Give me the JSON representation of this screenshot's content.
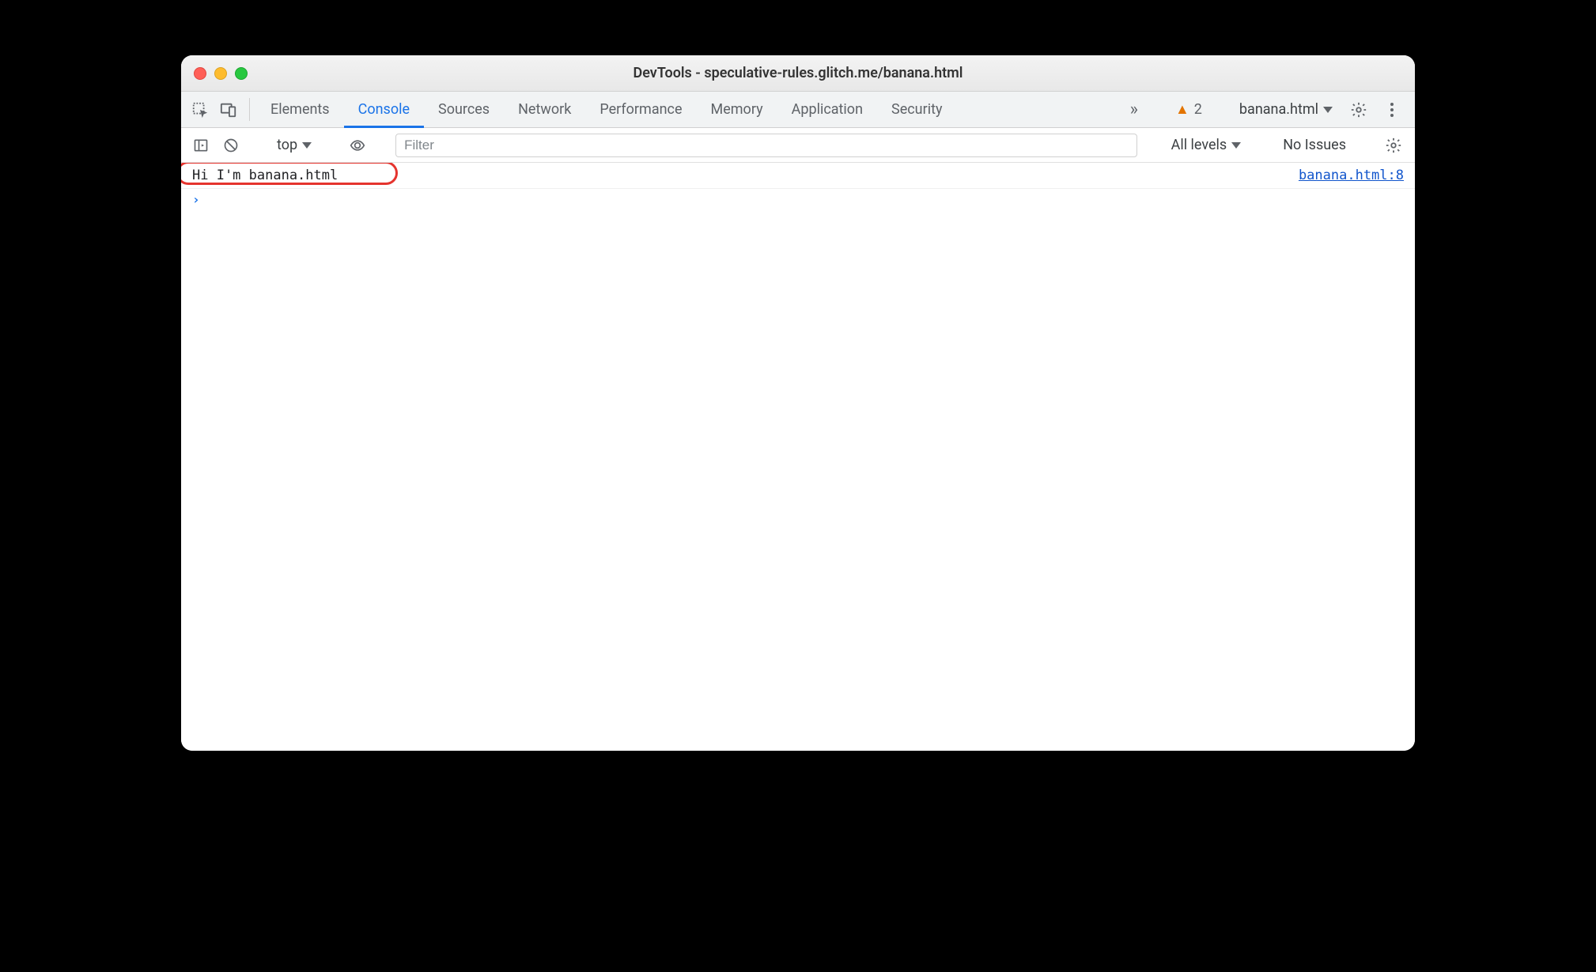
{
  "window": {
    "title": "DevTools - speculative-rules.glitch.me/banana.html"
  },
  "tabs": {
    "items": [
      {
        "label": "Elements"
      },
      {
        "label": "Console"
      },
      {
        "label": "Sources"
      },
      {
        "label": "Network"
      },
      {
        "label": "Performance"
      },
      {
        "label": "Memory"
      },
      {
        "label": "Application"
      },
      {
        "label": "Security"
      }
    ],
    "active_index": 1
  },
  "tabbar_right": {
    "warning_count": "2",
    "frame_selector": "banana.html"
  },
  "toolbar": {
    "context": "top",
    "filter_placeholder": "Filter",
    "levels_label": "All levels",
    "issues_label": "No Issues"
  },
  "console": {
    "log_message": "Hi I'm banana.html",
    "log_source": "banana.html:8"
  }
}
